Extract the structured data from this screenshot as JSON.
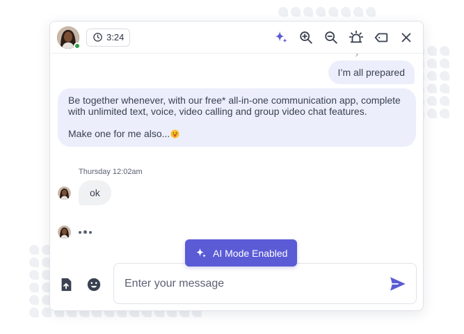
{
  "header": {
    "timer": "3:24",
    "icons": [
      "ai-sparkle-icon",
      "zoom-in-icon",
      "zoom-out-icon",
      "alert-siren-icon",
      "tag-label-icon",
      "close-icon"
    ]
  },
  "messages": {
    "outgoing_partial": "y",
    "outgoing": "I’m all prepared",
    "incoming_long": {
      "line1": "Be together whenever, with our free* all-in-one communication app, complete with unlimited text, voice, video calling and group video chat features.",
      "line2": "Make one for me also...",
      "emoji": "tongue-out-emoji"
    },
    "timestamp": "Thursday 12:02am",
    "incoming_short": "ok"
  },
  "ai_mode": {
    "label": "AI Mode Enabled"
  },
  "composer": {
    "placeholder": "Enter your message",
    "icons": [
      "upload-file-icon",
      "emoji-icon",
      "send-icon"
    ]
  },
  "colors": {
    "accent": "#5b5bd6",
    "bubble_outgoing": "#eceefb",
    "bubble_incoming": "#f0f1f3",
    "online": "#2f9e44"
  }
}
